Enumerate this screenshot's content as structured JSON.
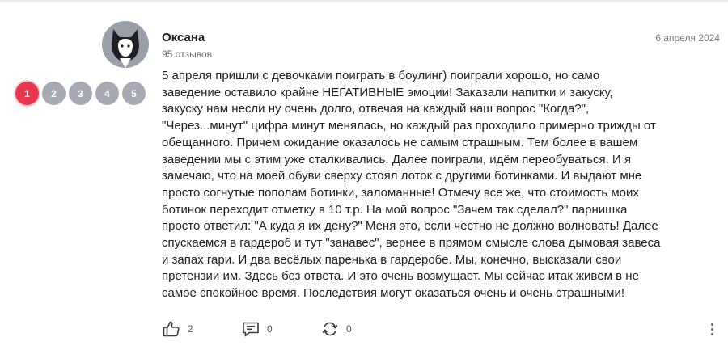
{
  "review": {
    "author": {
      "name": "Оксана",
      "reviews_count": "95 отзывов",
      "avatar_icon": "cat-silhouette-icon"
    },
    "date": "6 апреля 2024",
    "rating": {
      "options": [
        "1",
        "2",
        "3",
        "4",
        "5"
      ],
      "selected": 1,
      "active_color": "#e8374f",
      "inactive_color": "#a7aab5"
    },
    "text": "5 апреля пришли с девочками поиграть в боулинг) поиграли хорошо, но само\nзаведение оставило крайне НЕГАТИВНЫЕ эмоции! Заказали напитки и закуску,\nзакуску нам несли ну очень долго, отвечая на каждый наш вопрос \"Когда?\",\n\"Через...минут\" цифра минут менялась, но каждый раз проходило примерно трижды от\nобещанного. Причем ожидание оказалось не самым страшным. Тем более в вашем\nзаведении мы с этим уже сталкивались. Далее поиграли, идём переобуваться. И я\nзамечаю, что на моей обуви сверху стоял лоток с другими ботинками. И выдают мне\nпросто согнутые пополам ботинки, заломанные! Отмечу все же, что стоимость моих\nботинок переходит отметку в 10 т.р. На мой вопрос \"Зачем так сделал?\" парнишка\nпросто ответил: \"А куда я их дену?\" Меня это, если честно не должно волновать! Далее\nспускаемся в гардероб и тут \"занавес\", вернее в прямом смысле слова дымовая завеса\nи запах гари. И два весёлых паренька в гардеробе. Мы, конечно, высказали свои\nпретензии им. Здесь без ответа. И это очень возмущает. Мы сейчас итак живём в не\nсамое спокойное время. Последствия могут оказаться очень и очень страшными!",
    "actions": {
      "like": {
        "icon": "thumbs-up-icon",
        "count": "2"
      },
      "comment": {
        "icon": "comment-icon",
        "count": "0"
      },
      "repost": {
        "icon": "repost-icon",
        "count": "0"
      },
      "more": {
        "icon": "more-vertical-icon"
      }
    }
  }
}
